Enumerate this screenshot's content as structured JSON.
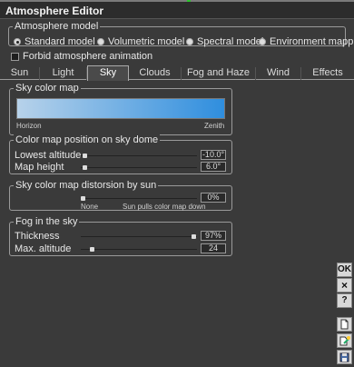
{
  "window": {
    "title": "Atmosphere Editor"
  },
  "model": {
    "legend": "Atmosphere model",
    "options": [
      {
        "label": "Standard model",
        "selected": true
      },
      {
        "label": "Volumetric model",
        "selected": false
      },
      {
        "label": "Spectral model",
        "selected": false
      },
      {
        "label": "Environment mapping",
        "selected": false
      }
    ]
  },
  "forbid_animation": {
    "label": "Forbid atmosphere animation",
    "checked": false
  },
  "tabs": [
    "Sun",
    "Light",
    "Sky",
    "Clouds",
    "Fog and Haze",
    "Wind",
    "Effects"
  ],
  "active_tab": "Sky",
  "sky_color_map": {
    "legend": "Sky color map",
    "left_label": "Horizon",
    "right_label": "Zenith",
    "gradient_start": "#b7d2ea",
    "gradient_end": "#2f8ede"
  },
  "position": {
    "legend": "Color map position on sky dome",
    "lowest_altitude": {
      "label": "Lowest altitude",
      "value": "-10.0°",
      "level": 0.02
    },
    "map_height": {
      "label": "Map height",
      "value": "6.0°",
      "level": 0.02
    }
  },
  "distortion": {
    "legend": "Sky color map distorsion by sun",
    "value": "0%",
    "left_label": "None",
    "right_label": "Sun pulls color map down",
    "level": 0.0
  },
  "fog": {
    "legend": "Fog in the sky",
    "thickness": {
      "label": "Thickness",
      "value": "97%",
      "level": 0.97
    },
    "max_altitude": {
      "label": "Max. altitude",
      "value": "24",
      "level": 0.08
    }
  },
  "side_buttons": {
    "ok": "OK",
    "cancel": "×",
    "help": "?"
  }
}
